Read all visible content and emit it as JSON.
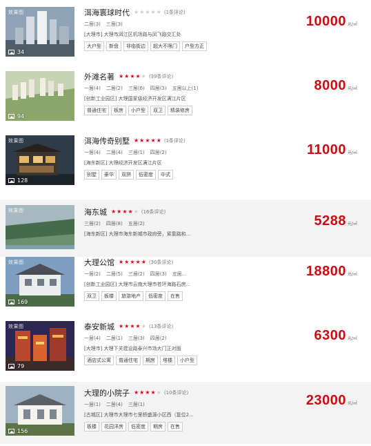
{
  "listings": [
    {
      "name": "洱海寰球时代",
      "stars": 0,
      "reviews": "(1条评论)",
      "layouts": [
        "二居(3)",
        "三居(3)"
      ],
      "address": "[大理市] 大理市洱江区机场路与凤飞路交汇处",
      "tags": [
        "大户型",
        "新盘",
        "非临街边",
        "超大不限门",
        "户型方正"
      ],
      "price": "10000",
      "unit": "元/㎡",
      "photo_count": "34",
      "thumb_tag": "效果图",
      "colors": [
        "#9fb3c7",
        "#5f6f7e",
        "#2e3a44"
      ]
    },
    {
      "name": "外滩名著",
      "stars": 3.5,
      "reviews": "(39条评论)",
      "layouts": [
        "一居(4)",
        "二居(2)",
        "三居(6)",
        "四居(3)",
        "五居以上(1)"
      ],
      "address": "[创新工业园区] 大理国家级经济开发区满江片区",
      "tags": [
        "普通住宅",
        "板房",
        "小户型",
        "双卫",
        "精装修房"
      ],
      "price": "8000",
      "unit": "元/㎡",
      "photo_count": "94",
      "thumb_tag": "",
      "colors": [
        "#c9d7b7",
        "#7e9a62",
        "#e3ddd0"
      ]
    },
    {
      "name": "洱海传奇别墅",
      "stars": 5,
      "reviews": "(1条评论)",
      "layouts": [
        "一居(4)",
        "二居(4)",
        "三居(1)",
        "四居(2)"
      ],
      "address": "[海东新区] 大理经济开发区满江片区",
      "tags": [
        "别墅",
        "豪华",
        "双拼",
        "低密度",
        "中式"
      ],
      "price": "11000",
      "unit": "元/㎡",
      "photo_count": "128",
      "thumb_tag": "效果图",
      "colors": [
        "#3d4c5c",
        "#1e252d",
        "#8c6b4a"
      ]
    },
    {
      "name": "海东城",
      "stars": 3.5,
      "reviews": "(16条评论)",
      "layouts": [
        "三居(2)",
        "四居(8)",
        "五居(2)"
      ],
      "address": "[海东新区] 大理市海东新城市政府旁，紧靠路和...",
      "tags": [],
      "price": "5288",
      "unit": "元/㎡",
      "photo_count": "",
      "thumb_tag": "效果图",
      "colors": [
        "#6f8f9c",
        "#2e5a3a",
        "#b7c9b3"
      ]
    },
    {
      "name": "大理公馆",
      "stars": 4.5,
      "reviews": "(30条评论)",
      "layouts": [
        "一居(2)",
        "二居(5)",
        "三居(2)",
        "四居(3)",
        "五居..."
      ],
      "address": "[创新工业园区] 大理市云南大理市苍环海路石房...",
      "tags": [
        "双卫",
        "板楼",
        "旅游地产",
        "低密度",
        "在售"
      ],
      "price": "18800",
      "unit": "元/㎡",
      "photo_count": "169",
      "thumb_tag": "效果图",
      "colors": [
        "#87a7c7",
        "#e6e7e8",
        "#3f5a3e"
      ]
    },
    {
      "name": "泰安新城",
      "stars": 4,
      "reviews": "(13条评论)",
      "layouts": [
        "一居(4)",
        "二居(1)",
        "三居(3)",
        "四居(2)"
      ],
      "address": "[大理市] 大理下关建设路泰兴市场大门正对面",
      "tags": [
        "酒店式公寓",
        "普通住宅",
        "期房",
        "塔楼",
        "小户型"
      ],
      "price": "6300",
      "unit": "元/㎡",
      "photo_count": "79",
      "thumb_tag": "效果图",
      "colors": [
        "#3a2f57",
        "#c24a2c",
        "#f1b04c"
      ]
    },
    {
      "name": "大理的小院子",
      "stars": 3.5,
      "reviews": "(10条评论)",
      "layouts": [
        "一居(1)",
        "二居(4)",
        "三居(1)"
      ],
      "address": "[古城区] 大理市大理市七里桥盛源小区西（复位2...",
      "tags": [
        "板楼",
        "花园洋房",
        "低密度",
        "期房",
        "在售"
      ],
      "price": "23000",
      "unit": "元/㎡",
      "photo_count": "156",
      "thumb_tag": "",
      "colors": [
        "#a9b9c8",
        "#f2f2ee",
        "#6a7d4a"
      ]
    }
  ]
}
